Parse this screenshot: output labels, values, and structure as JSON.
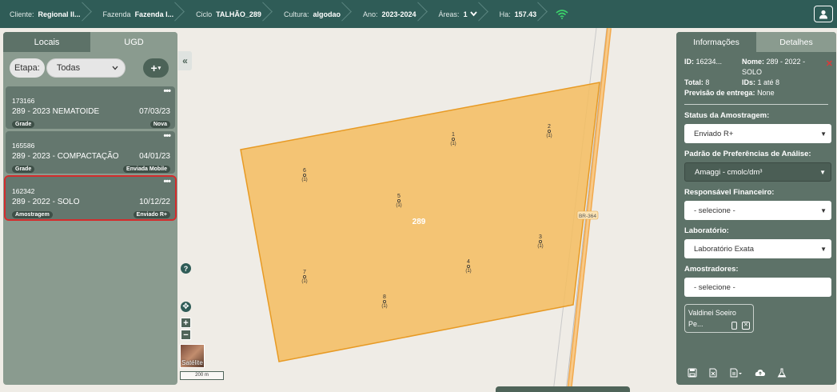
{
  "topbar": {
    "crumbs": [
      {
        "k": "Cliente:",
        "v": "Regional Il..."
      },
      {
        "k": "Fazenda",
        "v": "Fazenda I..."
      },
      {
        "k": "Ciclo",
        "v": "TALHÃO_289"
      },
      {
        "k": "Cultura:",
        "v": "algodao"
      },
      {
        "k": "Ano:",
        "v": "2023-2024"
      },
      {
        "k": "Áreas:",
        "v": "1"
      },
      {
        "k": "Ha:",
        "v": "157.43"
      }
    ],
    "accent": "#2f5c57"
  },
  "left": {
    "tabs": [
      "Locais",
      "UGD"
    ],
    "etapa_label": "Etapa:",
    "etapa_value": "Todas",
    "add_label": "+",
    "cards": [
      {
        "id": "173166",
        "name": "289 - 2023 NEMATOIDE",
        "date": "07/03/23",
        "type": "Grade",
        "status": "Nova"
      },
      {
        "id": "165586",
        "name": "289 - 2023 - COMPACTAÇÃO",
        "date": "04/01/23",
        "type": "Grade",
        "status": "Enviada Mobile"
      },
      {
        "id": "162342",
        "name": "289 - 2022 - SOLO",
        "date": "10/12/22",
        "type": "Amostragem",
        "status": "Enviado R+"
      }
    ]
  },
  "map": {
    "field_label": "289",
    "road_label": "BR-364",
    "points": [
      {
        "n": "1",
        "c": "(1)"
      },
      {
        "n": "2",
        "c": "(1)"
      },
      {
        "n": "3",
        "c": "(1)"
      },
      {
        "n": "4",
        "c": "(1)"
      },
      {
        "n": "5",
        "c": "(1)"
      },
      {
        "n": "6",
        "c": "(1)"
      },
      {
        "n": "7",
        "c": "(1)"
      },
      {
        "n": "8",
        "c": "(1)"
      }
    ],
    "help": "?",
    "zoom_in": "+",
    "zoom_out": "−",
    "satellite_label": "Satélite",
    "scale_label": "200 m",
    "field_color": "#f5bd5f"
  },
  "right": {
    "tabs": [
      "Informações",
      "Detalhes"
    ],
    "id_label": "ID:",
    "id_value": "16234...",
    "nome_label": "Nome:",
    "nome_value": "289 - 2022 - SOLO",
    "total_label": "Total:",
    "total_value": "8",
    "ids_label": "IDs:",
    "ids_value": "1 até 8",
    "previsao_label": "Previsão de entrega:",
    "previsao_value": "None",
    "status_label": "Status da Amostragem:",
    "status_value": "Enviado R+",
    "padrao_label": "Padrão de Preferências de Análise:",
    "padrao_value": "Amaggi - cmolc/dm³",
    "resp_label": "Responsável Financeiro:",
    "resp_value": "- selecione -",
    "lab_label": "Laboratório:",
    "lab_value": "Laboratório Exata",
    "amostr_label": "Amostradores:",
    "amostr_value": "- selecione -",
    "chip_line1": "Valdinei Soeiro",
    "chip_line2": "Pe..."
  }
}
